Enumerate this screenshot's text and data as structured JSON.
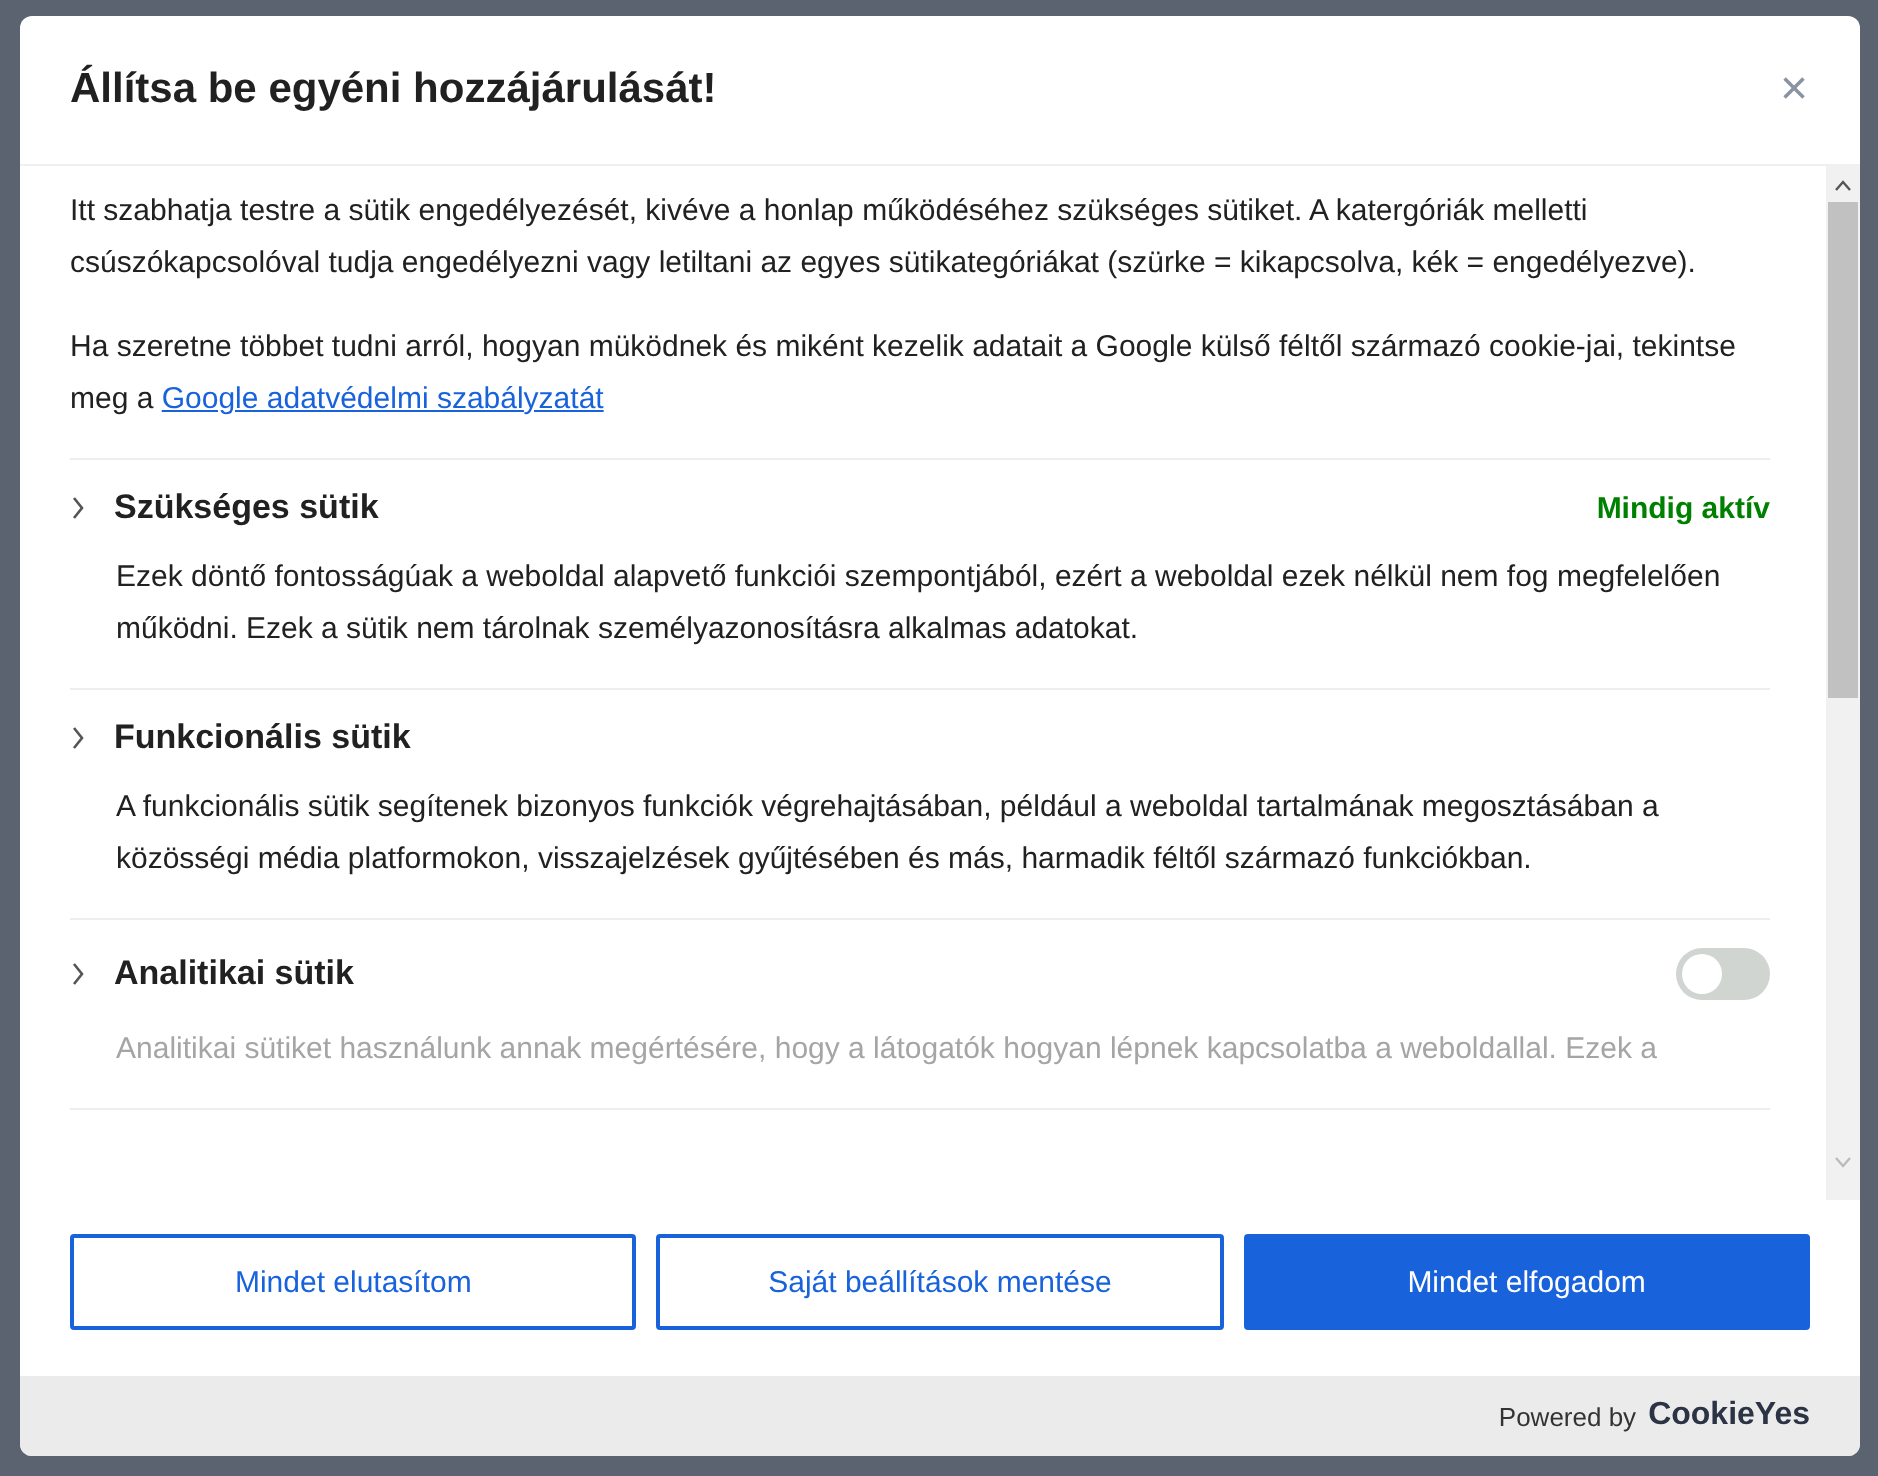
{
  "dialog": {
    "title": "Állítsa be egyéni hozzájárulását!",
    "close": "×"
  },
  "intro": [
    "Itt szabhatja testre a sütik engedélyezését, kivéve a honlap működéséhez szükséges sütiket. A katergóriák melletti csúszókapcsolóval tudja engedélyezni vagy letiltani  az egyes sütikategóriákat (szürke = kikapcsolva, kék = engedélyezve)."
  ],
  "google_note": {
    "text": "Ha szeretne többet tudni arról, hogyan müködnek és miként kezelik adatait a Google külső féltől származó cookie-jai, tekintse meg a",
    "link": "Google adatvédelmi szabályzatát"
  },
  "categories": [
    {
      "title": "Szükséges sütik",
      "kind": "always_active",
      "status": "Mindig aktív",
      "expanded": false,
      "description": "Ezek döntő fontosságúak a weboldal alapvető funkciói szempontjából, ezért a weboldal ezek nélkül nem fog megfelelően működni. Ezek a sütik nem tárolnak személyazonosításra alkalmas adatokat."
    },
    {
      "title": "Funkcionális sütik",
      "kind": "none",
      "expanded": false,
      "description": "A funkcionális sütik segítenek bizonyos funkciók végrehajtásában, például a weboldal tartalmának megosztásában a közösségi média platformokon, visszajelzések gyűjtésében és más, harmadik féltől származó funkciókban."
    },
    {
      "title": "Analitikai sütik",
      "kind": "toggle",
      "on": false,
      "expanded": false,
      "description": "Analitikai sütiket használunk annak megértésére, hogy a látogatók hogyan lépnek kapcsolatba a weboldallal. Ezek a"
    }
  ],
  "buttons": [
    {
      "label": "Mindet elutasítom",
      "kind": "outline"
    },
    {
      "label": "Saját beállítások mentése",
      "kind": "outline"
    },
    {
      "label": "Mindet elfogadom",
      "kind": "primary"
    }
  ],
  "footer": {
    "powered_by": "Powered by",
    "brand": "CookieYes"
  }
}
